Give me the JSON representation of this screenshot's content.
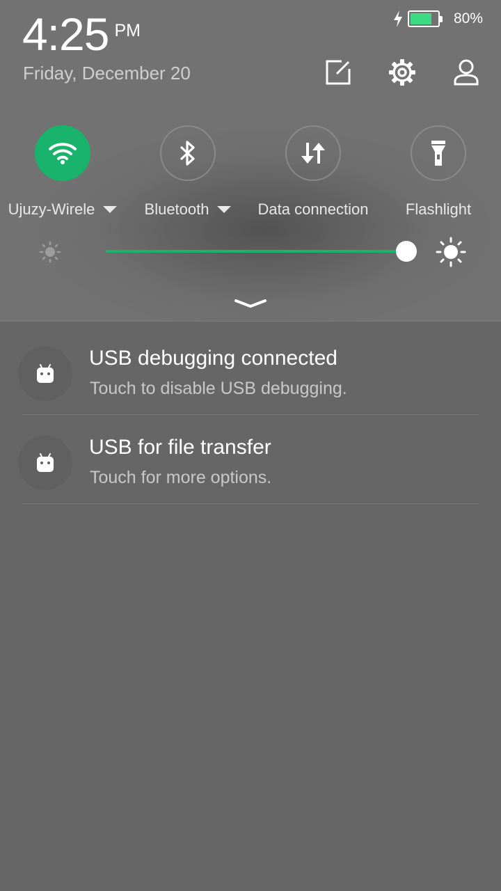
{
  "status": {
    "battery_text": "80%",
    "battery_level": 0.8,
    "charging": true,
    "battery_color": "#3ddc84"
  },
  "header": {
    "time": "4:25",
    "ampm": "PM",
    "date": "Friday, December 20",
    "icons": [
      "edit-icon",
      "settings-gear-icon",
      "user-account-icon"
    ]
  },
  "toggles": [
    {
      "label": "Ujuzy-Wirele",
      "icon": "wifi-icon",
      "active": true,
      "has_dropdown": true
    },
    {
      "label": "Bluetooth",
      "icon": "bluetooth-icon",
      "active": false,
      "has_dropdown": true
    },
    {
      "label": "Data connection",
      "icon": "data-arrows-icon",
      "active": false,
      "has_dropdown": false
    },
    {
      "label": "Flashlight",
      "icon": "flashlight-icon",
      "active": false,
      "has_dropdown": false
    }
  ],
  "brightness": {
    "level": 1.0,
    "accent_color": "#19b36b"
  },
  "notifications": [
    {
      "title": "USB debugging connected",
      "subtitle": "Touch to disable USB debugging.",
      "icon": "android-icon"
    },
    {
      "title": "USB for file transfer",
      "subtitle": "Touch for more options.",
      "icon": "android-icon"
    }
  ]
}
